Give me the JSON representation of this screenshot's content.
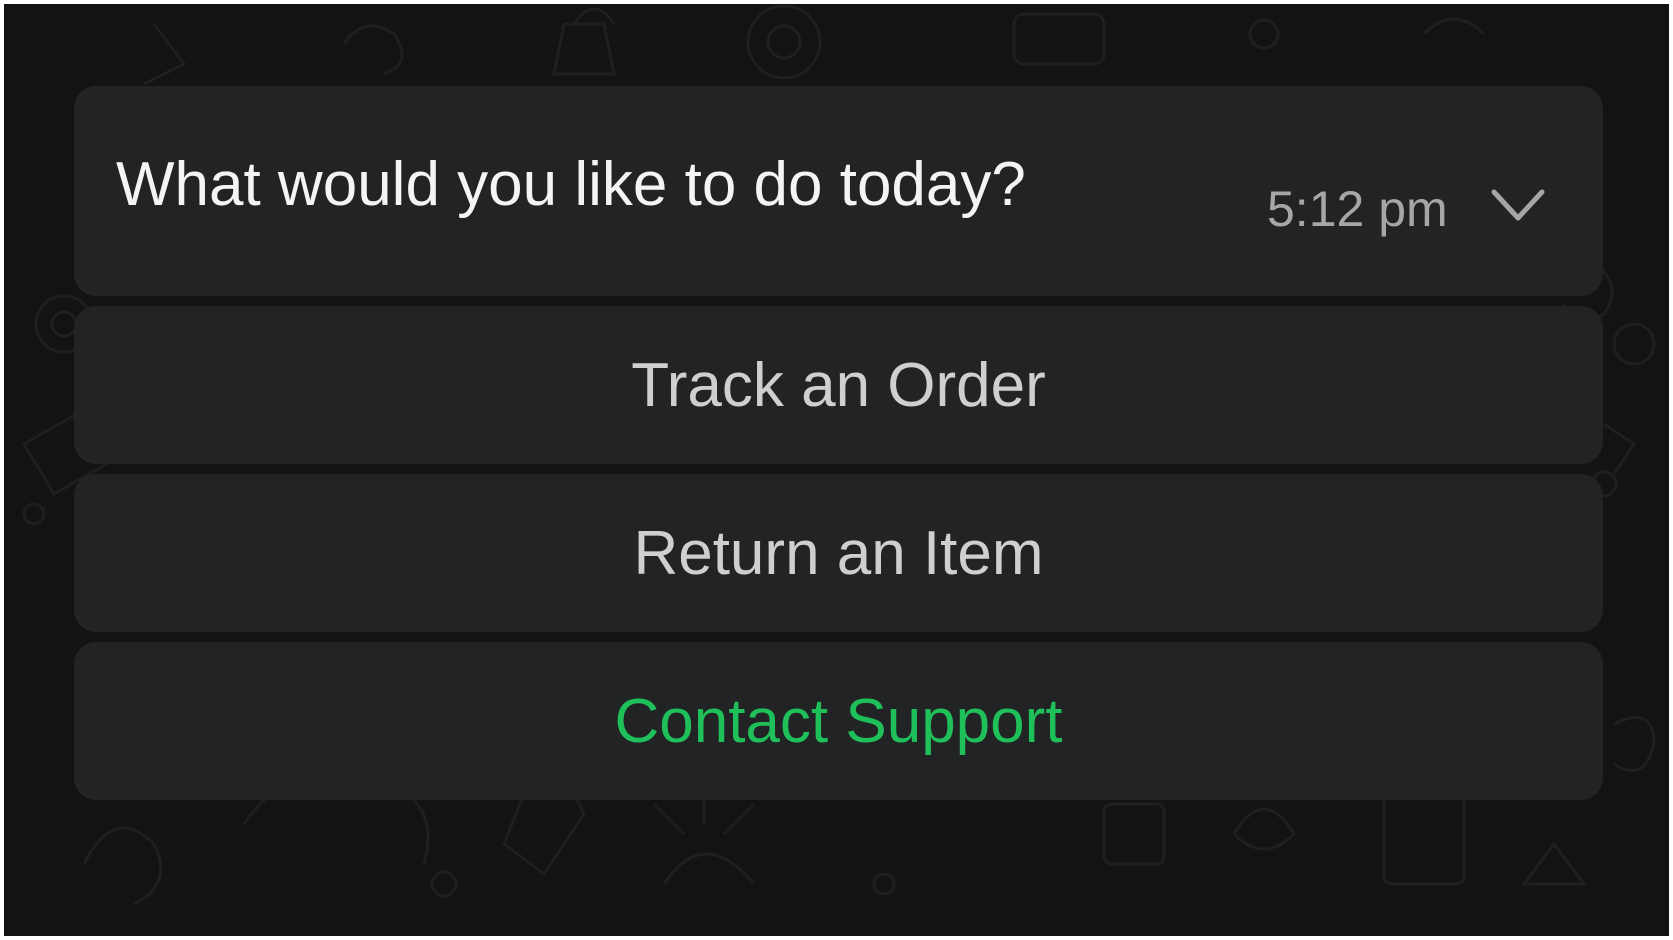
{
  "message": {
    "text": "What would you like to do today?",
    "time": "5:12 pm",
    "menu_icon": "chevron-down-icon"
  },
  "options": [
    {
      "label": "Track an Order",
      "color": "#cfcfcf"
    },
    {
      "label": "Return an Item",
      "color": "#cfcfcf"
    },
    {
      "label": "Contact Support",
      "color": "#1fc05a"
    }
  ],
  "colors": {
    "background": "#131313",
    "bubble": "#222324",
    "text_primary": "#f4f4f4",
    "text_muted": "#a6a6a6",
    "accent_green": "#1fc05a"
  }
}
